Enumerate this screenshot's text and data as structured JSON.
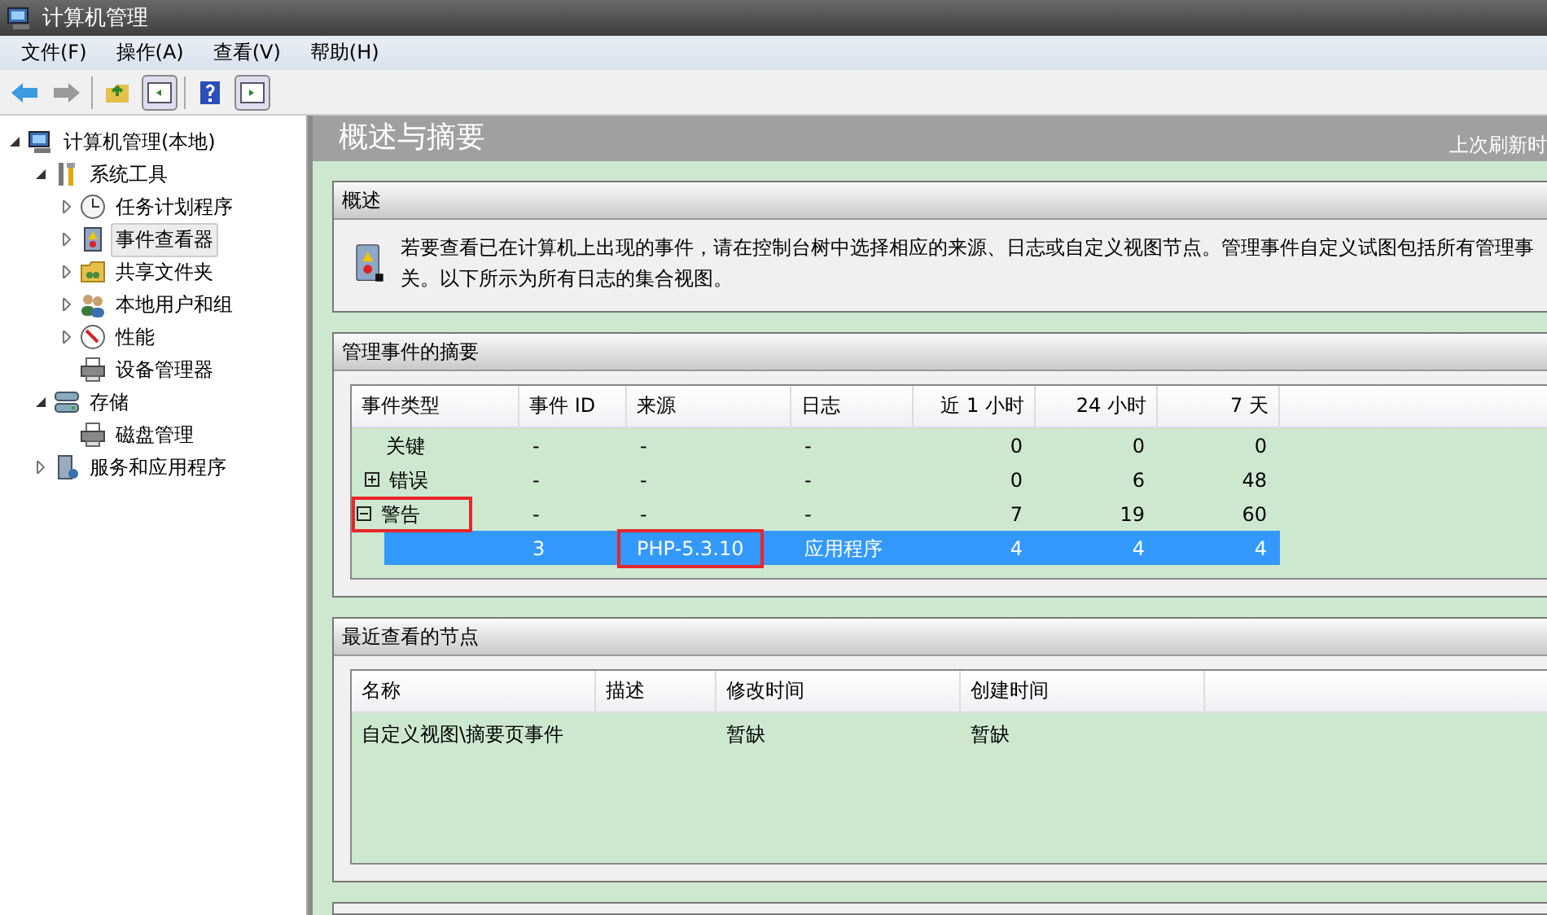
{
  "window": {
    "title": "计算机管理"
  },
  "menu": [
    "文件(F)",
    "操作(A)",
    "查看(V)",
    "帮助(H)"
  ],
  "tree": [
    {
      "label": "计算机管理(本地)",
      "expanded": true,
      "selected": false,
      "children": [
        {
          "label": "系统工具",
          "expanded": true,
          "selected": false,
          "children": [
            {
              "label": "任务计划程序",
              "expanded": false,
              "selected": false
            },
            {
              "label": "事件查看器",
              "expanded": false,
              "selected": true
            },
            {
              "label": "共享文件夹",
              "expanded": false,
              "selected": false
            },
            {
              "label": "本地用户和组",
              "expanded": false,
              "selected": false
            },
            {
              "label": "性能",
              "expanded": false,
              "selected": false
            },
            {
              "label": "设备管理器",
              "selected": false
            }
          ]
        },
        {
          "label": "存储",
          "expanded": true,
          "selected": false,
          "children": [
            {
              "label": "磁盘管理",
              "selected": false
            }
          ]
        },
        {
          "label": "服务和应用程序",
          "expanded": false,
          "selected": false
        }
      ]
    }
  ],
  "panel": {
    "title": "概述与摘要",
    "refresh": "上次刷新时"
  },
  "overview": {
    "title": "概述",
    "lines": [
      "若要查看已在计算机上出现的事件，请在控制台树中选择相应的来源、日志或自定义视图节点。管理事件自定义试图包括所有管理事",
      "关。以下所示为所有日志的集合视图。"
    ]
  },
  "summary": {
    "title": "管理事件的摘要",
    "columns": [
      "事件类型",
      "事件 ID",
      "来源",
      "日志",
      "近 1 小时",
      "24 小时",
      "7 天"
    ],
    "rows": [
      {
        "selected": false,
        "cells": [
          {
            "text": "关键",
            "framed": false
          },
          {
            "text": "-",
            "framed": false
          },
          {
            "text": "-",
            "framed": false
          },
          {
            "text": "-",
            "framed": false
          },
          {
            "text": "0",
            "framed": false
          },
          {
            "text": "0",
            "framed": false
          },
          {
            "text": "0",
            "framed": false
          }
        ]
      },
      {
        "selected": false,
        "expanded": false,
        "cells": [
          {
            "text": "错误",
            "framed": false
          },
          {
            "text": "-",
            "framed": false
          },
          {
            "text": "-",
            "framed": false
          },
          {
            "text": "-",
            "framed": false
          },
          {
            "text": "0",
            "framed": false
          },
          {
            "text": "6",
            "framed": false
          },
          {
            "text": "48",
            "framed": false
          }
        ]
      },
      {
        "selected": false,
        "expanded": true,
        "cells": [
          {
            "text": "警告",
            "framed": true
          },
          {
            "text": "-",
            "framed": false
          },
          {
            "text": "-",
            "framed": false
          },
          {
            "text": "-",
            "framed": false
          },
          {
            "text": "7",
            "framed": false
          },
          {
            "text": "19",
            "framed": false
          },
          {
            "text": "60",
            "framed": false
          }
        ],
        "children": [
          {
            "selected": true,
            "cells": [
              {
                "text": "3",
                "framed": false
              },
              {
                "text": "PHP-5.3.10",
                "framed": true
              },
              {
                "text": "应用程序",
                "framed": false
              },
              {
                "text": "4",
                "framed": false
              },
              {
                "text": "4",
                "framed": false
              },
              {
                "text": "4",
                "framed": false
              }
            ]
          }
        ]
      }
    ]
  },
  "recent": {
    "title": "最近查看的节点",
    "columns": [
      "名称",
      "描述",
      "修改时间",
      "创建时间"
    ],
    "rows": [
      {
        "cells": [
          "自定义视图\\摘要页事件",
          "",
          "暂缺",
          "暂缺"
        ]
      }
    ]
  }
}
